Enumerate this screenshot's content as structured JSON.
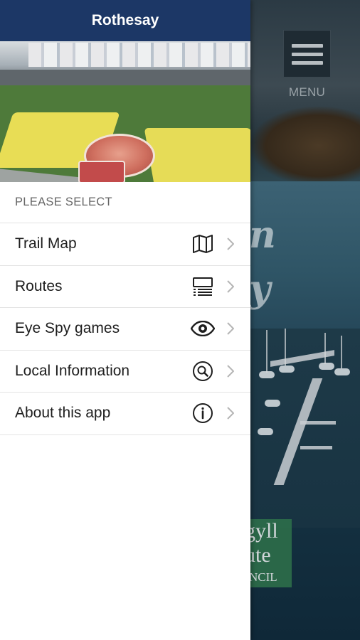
{
  "header": {
    "title": "Rothesay"
  },
  "hero": {
    "alt": ""
  },
  "drawer": {
    "section_label": "PLEASE SELECT",
    "items": [
      {
        "label": "Trail Map",
        "icon": "map-icon"
      },
      {
        "label": "Routes",
        "icon": "list-icon"
      },
      {
        "label": "Eye Spy games",
        "icon": "eye-icon"
      },
      {
        "label": "Local Information",
        "icon": "search-icon"
      },
      {
        "label": "About this app",
        "icon": "info-icon"
      }
    ]
  },
  "background": {
    "menu_label": "MENU",
    "council_lines": [
      "gyll",
      "ute",
      "NCIL"
    ]
  },
  "colors": {
    "header_bg": "#1c3766",
    "divider": "#e3e3e3",
    "text": "#1e1e1e",
    "muted": "#666666"
  }
}
